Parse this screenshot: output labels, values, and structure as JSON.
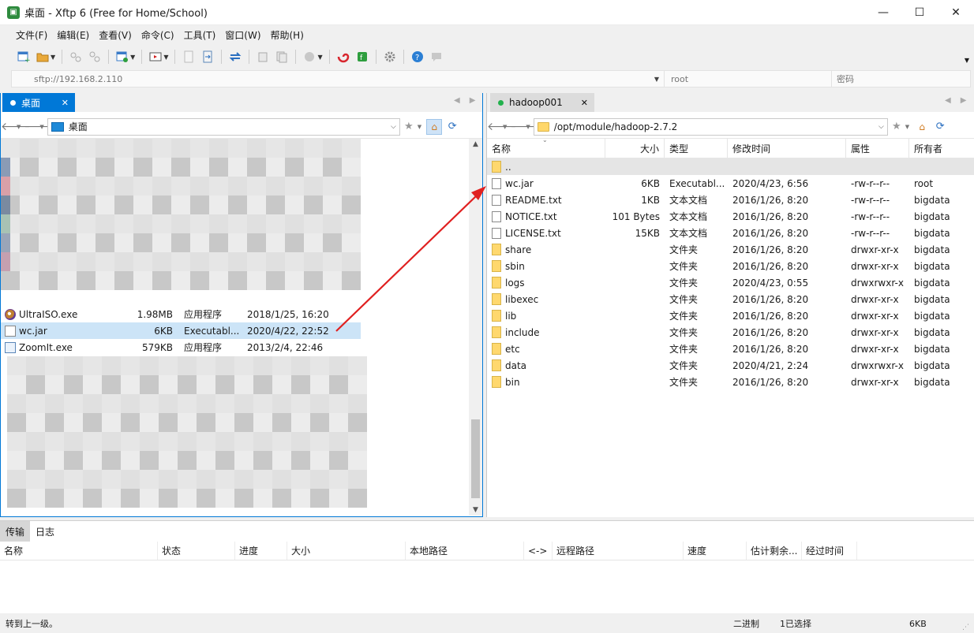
{
  "window": {
    "title": "桌面 - Xftp 6 (Free for Home/School)",
    "minimize": "—",
    "maximize": "☐",
    "close": "✕"
  },
  "menu": [
    "文件(F)",
    "编辑(E)",
    "查看(V)",
    "命令(C)",
    "工具(T)",
    "窗口(W)",
    "帮助(H)"
  ],
  "address": {
    "host_placeholder": "sftp://192.168.2.110",
    "user_placeholder": "root",
    "password_placeholder": "密码"
  },
  "left_pane": {
    "tab_label": "桌面",
    "tab_close": "✕",
    "path": "桌面",
    "files": [
      {
        "name": "UltraISO.exe",
        "size": "1.98MB",
        "type": "应用程序",
        "modified": "2018/1/25, 16:20",
        "icon": "ultraiso-icon"
      },
      {
        "name": "wc.jar",
        "size": "6KB",
        "type": "Executabl...",
        "modified": "2020/4/22, 22:52",
        "icon": "jar-icon"
      },
      {
        "name": "ZoomIt.exe",
        "size": "579KB",
        "type": "应用程序",
        "modified": "2013/2/4, 22:46",
        "icon": "zoomit-icon"
      }
    ]
  },
  "right_pane": {
    "tab_label": "hadoop001",
    "tab_close": "✕",
    "path": "/opt/module/hadoop-2.7.2",
    "columns": [
      "名称",
      "大小",
      "类型",
      "修改时间",
      "属性",
      "所有者"
    ],
    "parent_row": "..",
    "files": [
      {
        "name": "wc.jar",
        "size": "6KB",
        "type": "Executabl...",
        "modified": "2020/4/23, 6:56",
        "attrs": "-rw-r--r--",
        "owner": "root",
        "kind": "jar"
      },
      {
        "name": "README.txt",
        "size": "1KB",
        "type": "文本文档",
        "modified": "2016/1/26, 8:20",
        "attrs": "-rw-r--r--",
        "owner": "bigdata",
        "kind": "doc"
      },
      {
        "name": "NOTICE.txt",
        "size": "101 Bytes",
        "type": "文本文档",
        "modified": "2016/1/26, 8:20",
        "attrs": "-rw-r--r--",
        "owner": "bigdata",
        "kind": "doc"
      },
      {
        "name": "LICENSE.txt",
        "size": "15KB",
        "type": "文本文档",
        "modified": "2016/1/26, 8:20",
        "attrs": "-rw-r--r--",
        "owner": "bigdata",
        "kind": "doc"
      },
      {
        "name": "share",
        "size": "",
        "type": "文件夹",
        "modified": "2016/1/26, 8:20",
        "attrs": "drwxr-xr-x",
        "owner": "bigdata",
        "kind": "folder"
      },
      {
        "name": "sbin",
        "size": "",
        "type": "文件夹",
        "modified": "2016/1/26, 8:20",
        "attrs": "drwxr-xr-x",
        "owner": "bigdata",
        "kind": "folder"
      },
      {
        "name": "logs",
        "size": "",
        "type": "文件夹",
        "modified": "2020/4/23, 0:55",
        "attrs": "drwxrwxr-x",
        "owner": "bigdata",
        "kind": "folder"
      },
      {
        "name": "libexec",
        "size": "",
        "type": "文件夹",
        "modified": "2016/1/26, 8:20",
        "attrs": "drwxr-xr-x",
        "owner": "bigdata",
        "kind": "folder"
      },
      {
        "name": "lib",
        "size": "",
        "type": "文件夹",
        "modified": "2016/1/26, 8:20",
        "attrs": "drwxr-xr-x",
        "owner": "bigdata",
        "kind": "folder"
      },
      {
        "name": "include",
        "size": "",
        "type": "文件夹",
        "modified": "2016/1/26, 8:20",
        "attrs": "drwxr-xr-x",
        "owner": "bigdata",
        "kind": "folder"
      },
      {
        "name": "etc",
        "size": "",
        "type": "文件夹",
        "modified": "2016/1/26, 8:20",
        "attrs": "drwxr-xr-x",
        "owner": "bigdata",
        "kind": "folder"
      },
      {
        "name": "data",
        "size": "",
        "type": "文件夹",
        "modified": "2020/4/21, 2:24",
        "attrs": "drwxrwxr-x",
        "owner": "bigdata",
        "kind": "folder"
      },
      {
        "name": "bin",
        "size": "",
        "type": "文件夹",
        "modified": "2016/1/26, 8:20",
        "attrs": "drwxr-xr-x",
        "owner": "bigdata",
        "kind": "folder"
      }
    ]
  },
  "transfer": {
    "tabs": [
      "传输",
      "日志"
    ],
    "columns": [
      "名称",
      "状态",
      "进度",
      "大小",
      "本地路径",
      "<->",
      "远程路径",
      "速度",
      "估计剩余...",
      "经过时间"
    ]
  },
  "status": {
    "message": "转到上一级。",
    "mode": "二进制",
    "selection": "1已选择",
    "size": "6KB"
  },
  "colors": {
    "accent": "#0078d7",
    "arrow": "#e02020",
    "connected_dot": "#22b14c"
  }
}
